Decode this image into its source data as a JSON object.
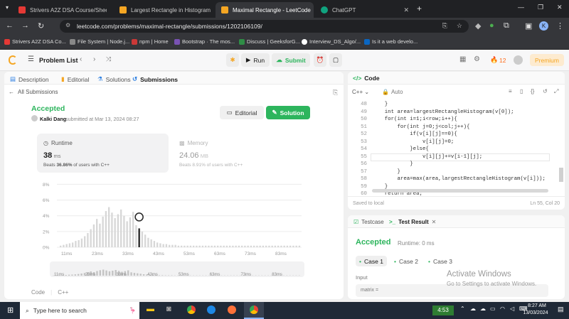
{
  "browser": {
    "tabs": [
      {
        "title": "Strivers A2Z DSA Course/Sheet",
        "color": "#e53935"
      },
      {
        "title": "Largest Rectangle in Histogram",
        "color": "#f5a623"
      },
      {
        "title": "Maximal Rectangle - LeetCode",
        "color": "#f5a623"
      },
      {
        "title": "ChatGPT",
        "color": "#10a37f"
      }
    ],
    "url": "leetcode.com/problems/maximal-rectangle/submissions/1202106109/",
    "bookmarks": [
      "Strivers A2Z DSA Co...",
      "File System | Node.j...",
      "npm | Home",
      "Bootstrap · The mos...",
      "Discuss | GeeksforG...",
      "Interview_DS_Algo/...",
      "Is it a web develo..."
    ],
    "profile_initial": "K"
  },
  "lc_header": {
    "problem_list": "Problem List",
    "run": "Run",
    "submit": "Submit",
    "streak": "12",
    "premium": "Premium"
  },
  "left": {
    "tabs": [
      "Description",
      "Editorial",
      "Solutions",
      "Submissions"
    ],
    "back": "All Submissions",
    "status": "Accepted",
    "user": "Kalki Dang",
    "submitted": "submitted at Mar 13, 2024 08:27",
    "editorial_btn": "Editorial",
    "solution_btn": "Solution",
    "runtime_label": "Runtime",
    "runtime_value": "38",
    "runtime_unit": "ms",
    "runtime_beats": "Beats",
    "runtime_pct": "36.86%",
    "runtime_suffix": "of users with C++",
    "memory_label": "Memory",
    "memory_value": "24.06",
    "memory_unit": "MB",
    "memory_beats": "Beats 8.91% of users with C++",
    "code_label": "Code",
    "lang": "C++"
  },
  "chart_data": {
    "type": "bar",
    "ytick_labels": [
      "0%",
      "2%",
      "4%",
      "6%",
      "8%"
    ],
    "ylim": [
      0,
      8.4
    ],
    "xtick_labels": [
      "11ms",
      "23ms",
      "33ms",
      "43ms",
      "53ms",
      "63ms",
      "73ms",
      "83ms"
    ],
    "values": [
      0.2,
      0.3,
      0.4,
      0.5,
      0.6,
      0.8,
      0.9,
      1.1,
      1.4,
      1.8,
      2.3,
      2.9,
      3.6,
      3.0,
      3.9,
      4.6,
      5.1,
      4.4,
      3.7,
      4.2,
      4.8,
      4.0,
      3.3,
      3.8,
      4.5,
      2.8,
      2.4,
      2.0,
      1.6,
      1.2,
      1.0,
      0.8,
      0.6,
      0.5,
      0.4,
      0.4,
      0.3,
      0.3,
      0.3,
      0.2,
      0.2,
      0.2,
      0.2,
      0.2,
      0.2,
      0.2,
      0.2,
      0.2,
      0.2,
      0.2,
      0.2,
      0.2,
      0.2,
      0.2,
      0.2,
      0.2,
      0.2,
      0.2,
      0.2,
      0.2,
      0.2,
      0.2,
      0.2,
      0.2,
      0.2,
      0.2,
      0.2,
      0.2,
      0.2,
      0.2,
      0.2,
      0.2,
      0.2,
      0.2,
      0.2,
      0.2,
      0.2,
      0.2,
      0.2,
      0.2
    ],
    "highlight_index": 26,
    "grid": true
  },
  "editor": {
    "title": "Code",
    "lang": "C++",
    "mode": "Auto",
    "lines": [
      {
        "n": "48",
        "t": "    }"
      },
      {
        "n": "49",
        "t": "    int area=largestRectangleHistogram(v[0]);"
      },
      {
        "n": "50",
        "t": "    for(int i=1;i<row;i++){"
      },
      {
        "n": "51",
        "t": "        for(int j=0;j<col;j++){"
      },
      {
        "n": "52",
        "t": "            if(v[i][j]==0){"
      },
      {
        "n": "53",
        "t": "                v[i][j]=0;"
      },
      {
        "n": "54",
        "t": "            }else{"
      },
      {
        "n": "55",
        "t": "                v[i][j]+=v[i-1][j];"
      },
      {
        "n": "56",
        "t": "            }"
      },
      {
        "n": "57",
        "t": "        }"
      },
      {
        "n": "58",
        "t": "        area=max(area,largestRectangleHistogram(v[i]));"
      },
      {
        "n": "59",
        "t": "    }"
      },
      {
        "n": "60",
        "t": "    return area;"
      }
    ],
    "saved": "Saved to local",
    "cursor": "Ln 55, Col 20"
  },
  "console": {
    "testcase_tab": "Testcase",
    "result_tab": "Test Result",
    "status": "Accepted",
    "runtime": "Runtime: 0 ms",
    "cases": [
      "Case 1",
      "Case 2",
      "Case 3"
    ],
    "input_label": "Input",
    "input_var": "matrix ="
  },
  "watermark": {
    "title": "Activate Windows",
    "sub": "Go to Settings to activate Windows."
  },
  "taskbar": {
    "search": "Type here to search",
    "battery": "4:53",
    "time": "8:27 AM",
    "date": "13/03/2024"
  }
}
